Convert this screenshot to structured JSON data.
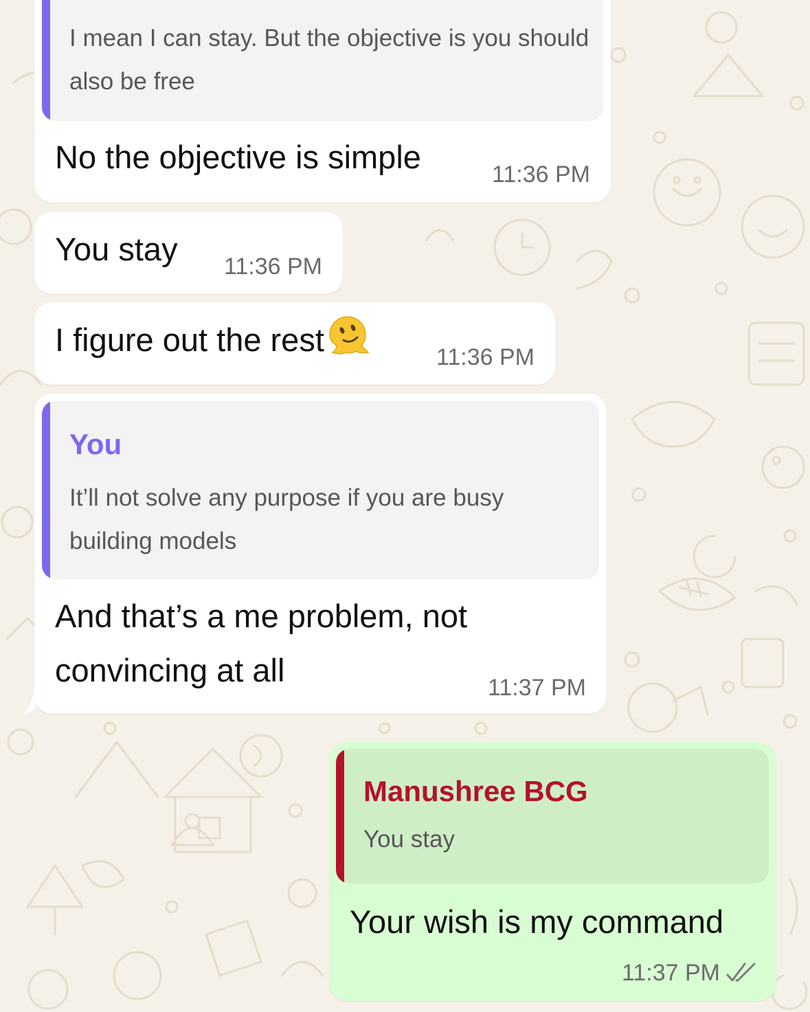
{
  "colors": {
    "wallpaper": "#f5f0e8",
    "incoming_bubble": "#ffffff",
    "outgoing_bubble": "#d9fdd3",
    "quote_self_accent": "#7b68ee",
    "quote_contact_accent": "#b5112e",
    "timestamp": "#6b6b6b"
  },
  "messages": [
    {
      "direction": "incoming",
      "quote": {
        "text": "I mean I can stay. But the objective is you should also be free"
      },
      "text": "No the objective is simple",
      "time": "11:36 PM"
    },
    {
      "direction": "incoming",
      "text": "You stay",
      "time": "11:36 PM"
    },
    {
      "direction": "incoming",
      "text": "I figure out the rest",
      "emoji": "melting-face",
      "time": "11:36 PM"
    },
    {
      "direction": "incoming",
      "quote": {
        "author": "You",
        "text": "It’ll not solve any purpose if you are busy building models"
      },
      "text": "And that’s a me problem, not convincing at all",
      "time": "11:37 PM"
    },
    {
      "direction": "outgoing",
      "quote": {
        "author": "Manushree BCG",
        "text": "You stay"
      },
      "text": "Your wish is my command",
      "time": "11:37 PM",
      "status": "read-double-tick"
    }
  ]
}
